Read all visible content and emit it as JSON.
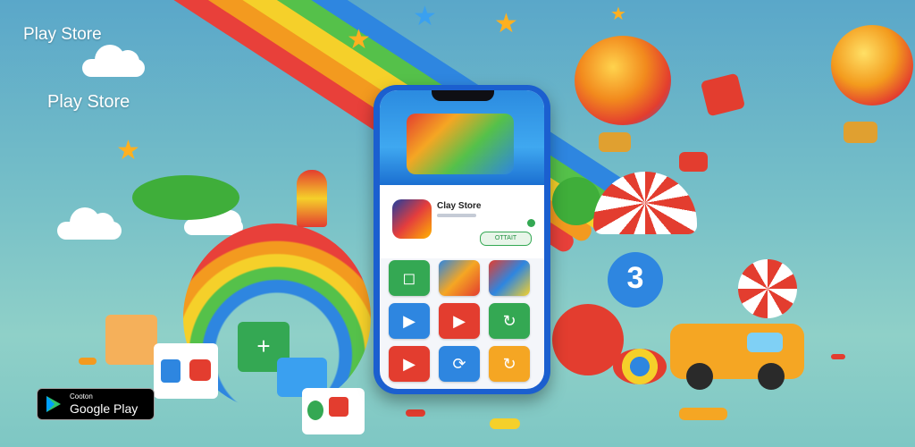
{
  "promo": {
    "caption_top": "Play Store",
    "caption_middle": "Play Store"
  },
  "phone": {
    "app_title": "Clay Store",
    "install_label": "OTTAIT"
  },
  "badge": {
    "small_text": "Cooton",
    "big_text": "Google Play"
  },
  "toys": {
    "ball_number": "3"
  },
  "colors": {
    "phone_body": "#1b5fcf",
    "accent_green": "#34a853",
    "badge_bg": "#000000"
  },
  "icons": [
    "google-play-triangle-icon",
    "youtube-play-icon",
    "play-button-icon",
    "refresh-icon",
    "plus-icon",
    "star-icon",
    "cloud-icon"
  ]
}
